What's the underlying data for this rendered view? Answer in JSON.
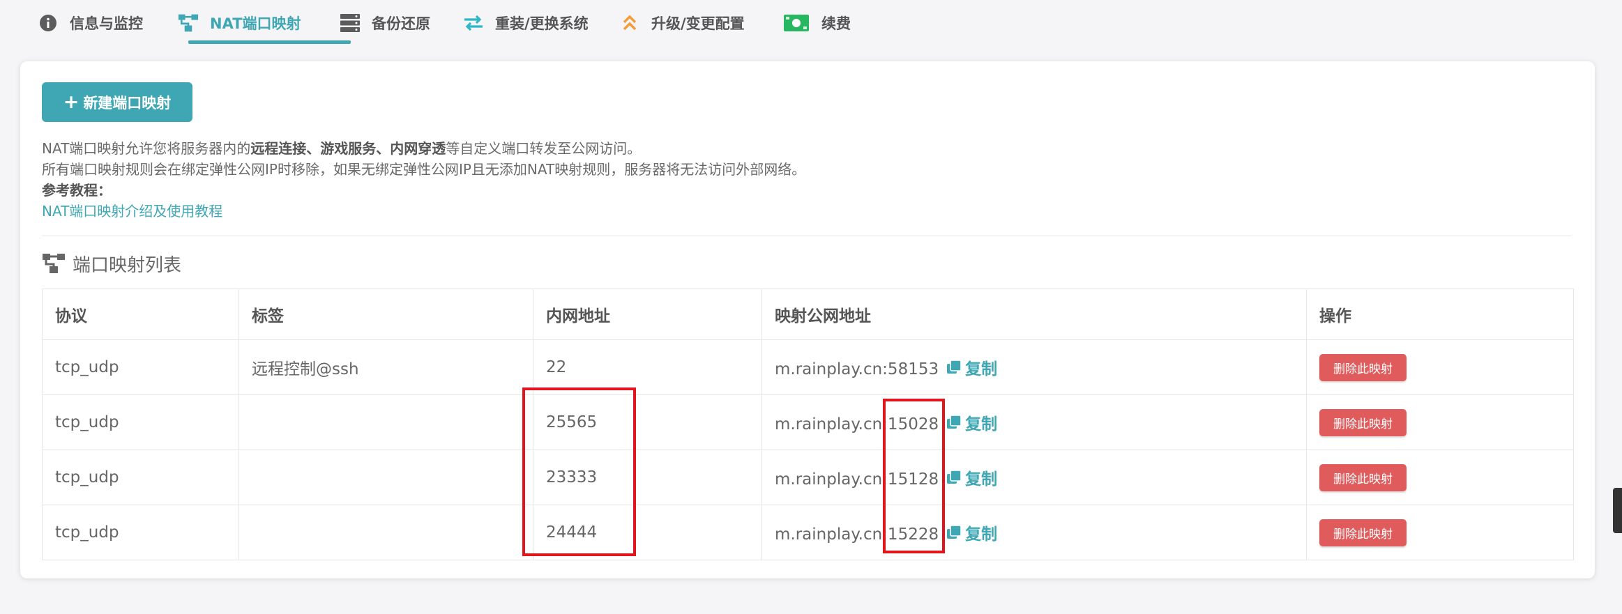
{
  "tabs": [
    {
      "label": "信息与监控",
      "icon": "info-circle-icon",
      "active": false
    },
    {
      "label": "NAT端口映射",
      "icon": "sitemap-icon",
      "active": true
    },
    {
      "label": "备份还原",
      "icon": "server-icon",
      "active": false
    },
    {
      "label": "重装/更换系统",
      "icon": "exchange-icon",
      "active": false
    },
    {
      "label": "升级/变更配置",
      "icon": "double-up-icon",
      "active": false
    },
    {
      "label": "续费",
      "icon": "money-icon",
      "active": false
    }
  ],
  "colors": {
    "accent": "#3fa7b4",
    "danger": "#e05c5c",
    "highlight": "#e1151c"
  },
  "new_button": {
    "label": "新建端口映射",
    "icon": "plus-icon"
  },
  "description": {
    "line1_prefix": "NAT端口映射允许您将服务器内的",
    "line1_bold": "远程连接、游戏服务、内网穿透",
    "line1_suffix": "等自定义端口转发至公网访问。",
    "line2": "所有端口映射规则会在绑定弹性公网IP时移除，如果无绑定弹性公网IP且无添加NAT映射规则，服务器将无法访问外部网络。",
    "reference_label": "参考教程：",
    "tutorial_link": "NAT端口映射介绍及使用教程"
  },
  "list_title": "端口映射列表",
  "table": {
    "headers": [
      "协议",
      "标签",
      "内网地址",
      "映射公网地址",
      "操作"
    ],
    "copy_label": "复制",
    "delete_label": "删除此映射",
    "rows": [
      {
        "protocol": "tcp_udp",
        "tag": "远程控制@ssh",
        "internal": "22",
        "public": "m.rainplay.cn:58153"
      },
      {
        "protocol": "tcp_udp",
        "tag": "",
        "internal": "25565",
        "public": "m.rainplay.cn:15028"
      },
      {
        "protocol": "tcp_udp",
        "tag": "",
        "internal": "23333",
        "public": "m.rainplay.cn:15128"
      },
      {
        "protocol": "tcp_udp",
        "tag": "",
        "internal": "24444",
        "public": "m.rainplay.cn:15228"
      }
    ]
  }
}
